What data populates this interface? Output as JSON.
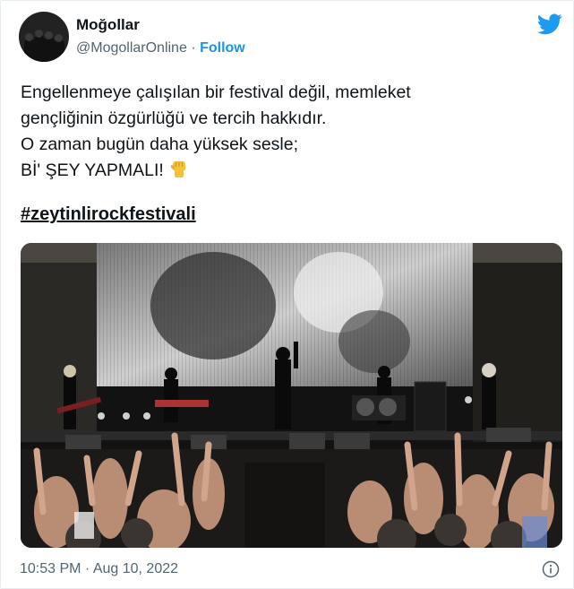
{
  "author": {
    "name": "Moğollar",
    "handle": "@MogollarOnline",
    "separator": "·",
    "follow_label": "Follow"
  },
  "tweet": {
    "lines": [
      "Engellenmeye çalışılan bir festival değil, memleket",
      "gençliğinin özgürlüğü ve tercih hakkıdır.",
      "O zaman bugün daha yüksek sesle;",
      "Bİ' ŞEY YAPMALI!"
    ],
    "hashtag": "#zeytinlirockfestivali",
    "emoji": "raised-fist-icon"
  },
  "media": {
    "icon": "concert-photo"
  },
  "footer": {
    "timestamp": "10:53 PM · Aug 10, 2022"
  },
  "colors": {
    "accent": "#1b95e0",
    "text": "#0f1419",
    "muted": "#536471",
    "twitter_blue": "#1d9bf0",
    "emoji_yellow": "#f5c33b"
  }
}
